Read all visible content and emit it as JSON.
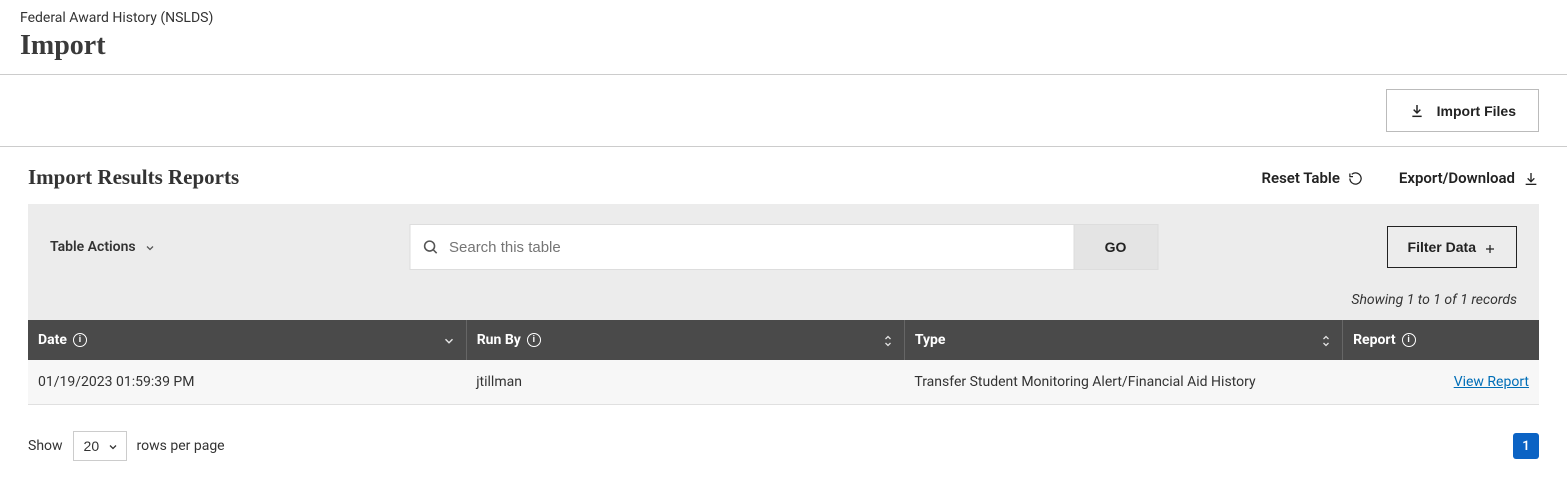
{
  "breadcrumb": "Federal Award History (NSLDS)",
  "page_title": "Import",
  "toolbar": {
    "import_files": "Import Files"
  },
  "section": {
    "title": "Import Results Reports",
    "reset_table": "Reset Table",
    "export_download": "Export/Download"
  },
  "panel": {
    "table_actions": "Table Actions",
    "search_placeholder": "Search this table",
    "go": "GO",
    "filter_data": "Filter Data",
    "records_info": "Showing 1 to 1 of 1 records"
  },
  "columns": {
    "date": "Date",
    "run_by": "Run By",
    "type": "Type",
    "report": "Report"
  },
  "rows": [
    {
      "date": "01/19/2023 01:59:39 PM",
      "run_by": "jtillman",
      "type": "Transfer Student Monitoring Alert/Financial Aid History",
      "report_link": "View Report"
    }
  ],
  "footer": {
    "show": "Show",
    "rows_per_page": "rows per page",
    "page_size": "20",
    "current_page": "1"
  }
}
